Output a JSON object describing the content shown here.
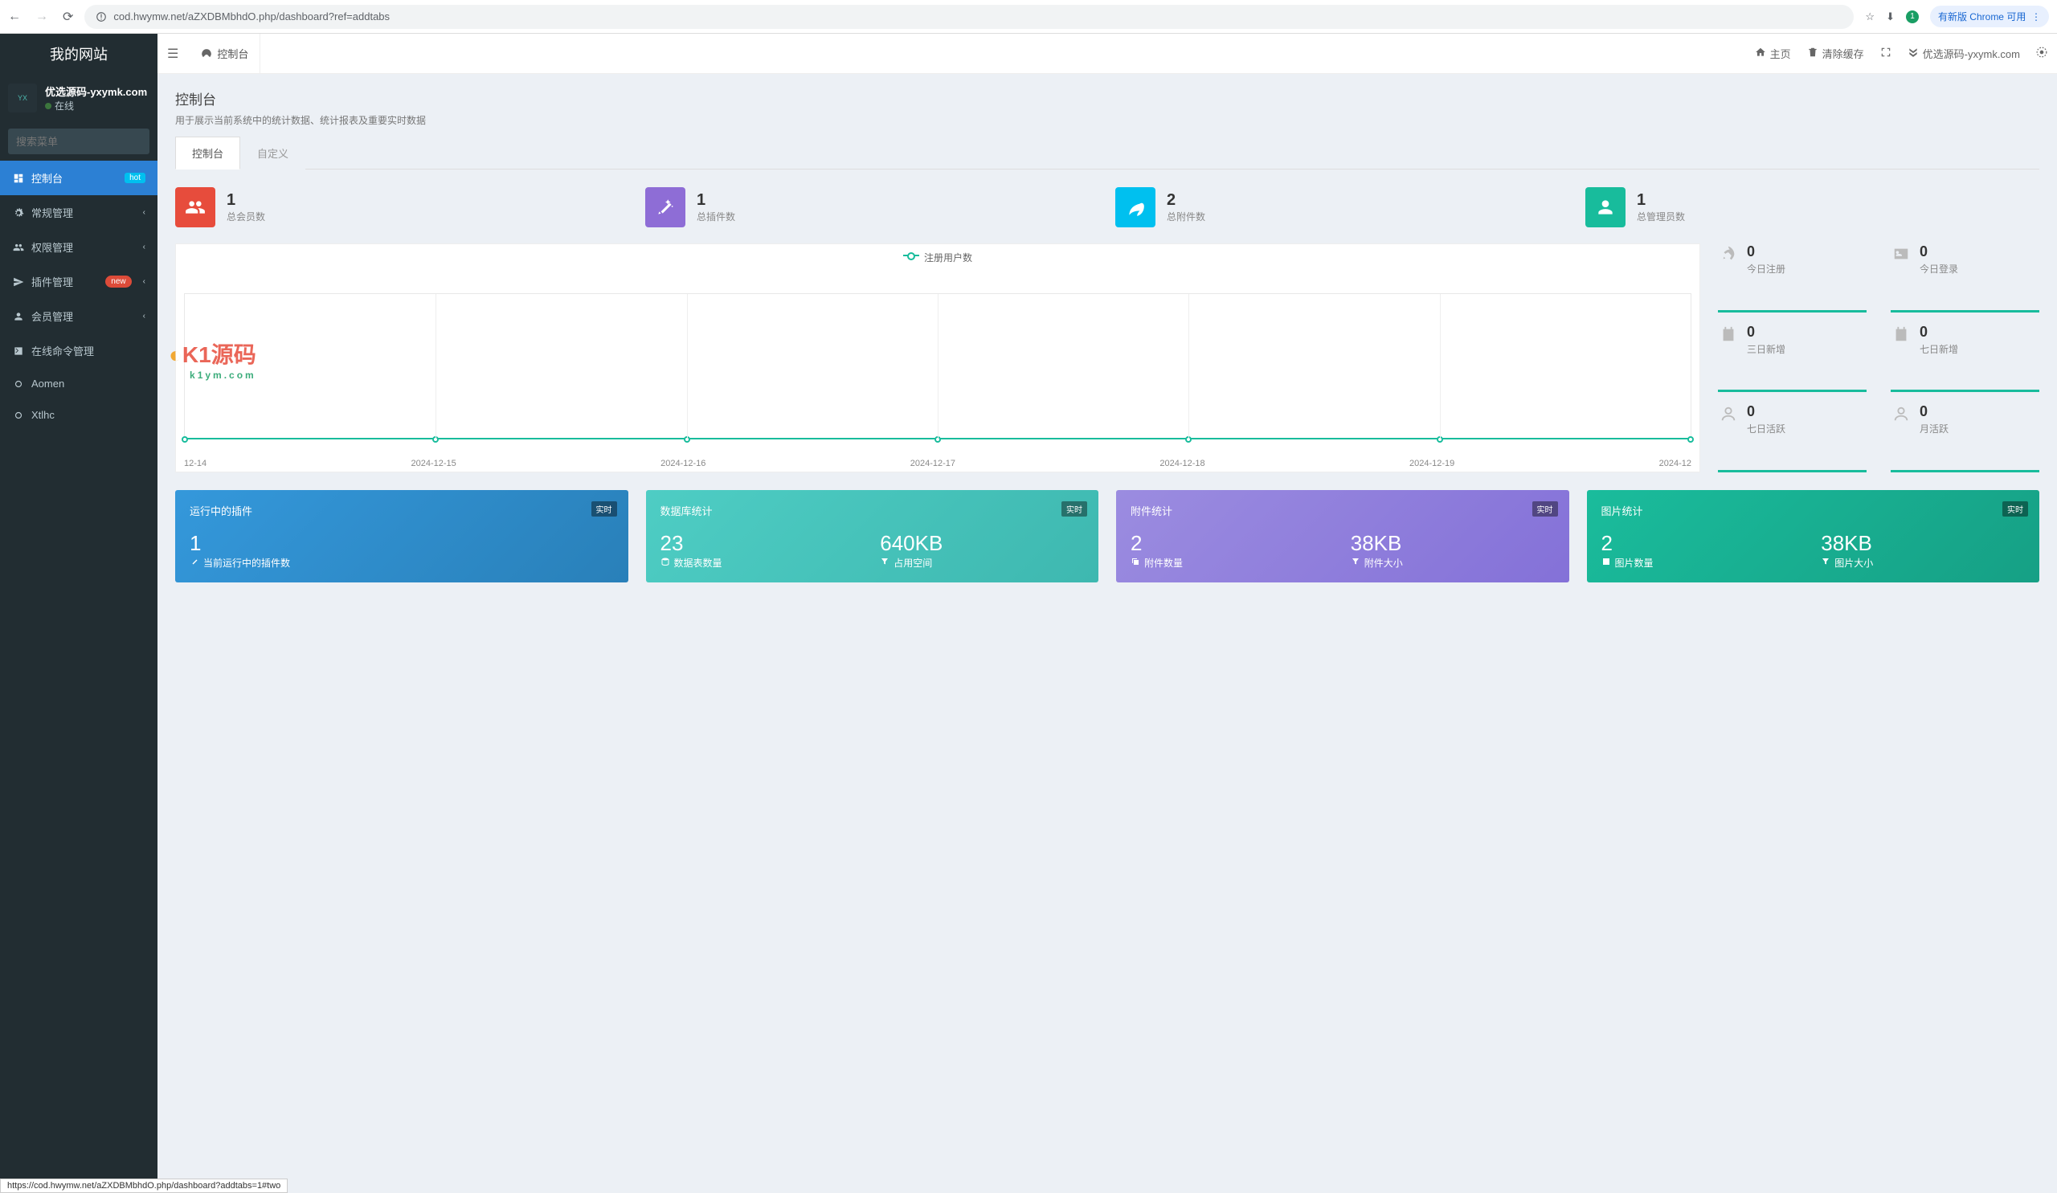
{
  "browser": {
    "url": "cod.hwymw.net/aZXDBMbhdO.php/dashboard?ref=addtabs",
    "chrome_update": "有新版 Chrome 可用",
    "avatar_badge": "1"
  },
  "sidebar": {
    "brand": "我的网站",
    "user_name": "优选源码-yxymk.com",
    "user_status": "在线",
    "search_placeholder": "搜索菜单",
    "items": [
      {
        "icon": "dashboard",
        "label": "控制台",
        "badge": "hot",
        "badge_class": "hot",
        "active": true
      },
      {
        "icon": "cogs",
        "label": "常规管理",
        "caret": true
      },
      {
        "icon": "users",
        "label": "权限管理",
        "caret": true
      },
      {
        "icon": "plane",
        "label": "插件管理",
        "badge": "new",
        "badge_class": "new",
        "caret": true
      },
      {
        "icon": "user",
        "label": "会员管理",
        "caret": true
      },
      {
        "icon": "terminal",
        "label": "在线命令管理"
      },
      {
        "icon": "circle",
        "label": "Aomen"
      },
      {
        "icon": "circle",
        "label": "Xtlhc"
      }
    ]
  },
  "topbar": {
    "tab_label": "控制台",
    "right": [
      {
        "icon": "home",
        "label": "主页"
      },
      {
        "icon": "trash",
        "label": "清除缓存"
      },
      {
        "icon": "expand",
        "label": ""
      },
      {
        "icon": "logo",
        "label": "优选源码-yxymk.com"
      },
      {
        "icon": "gears",
        "label": ""
      }
    ]
  },
  "page": {
    "title": "控制台",
    "subtitle": "用于展示当前系统中的统计数据、统计报表及重要实时数据",
    "subtabs": [
      "控制台",
      "自定义"
    ]
  },
  "stat_cards": [
    {
      "color": "c-red",
      "icon": "users",
      "num": "1",
      "label": "总会员数"
    },
    {
      "color": "c-purple",
      "icon": "wand",
      "num": "1",
      "label": "总插件数"
    },
    {
      "color": "c-blue",
      "icon": "leaf",
      "num": "2",
      "label": "总附件数"
    },
    {
      "color": "c-green",
      "icon": "user",
      "num": "1",
      "label": "总管理员数"
    }
  ],
  "chart_data": {
    "type": "line",
    "title": "",
    "legend": "注册用户数",
    "categories": [
      "12-14",
      "2024-12-15",
      "2024-12-16",
      "2024-12-17",
      "2024-12-18",
      "2024-12-19",
      "2024-12"
    ],
    "series": [
      {
        "name": "注册用户数",
        "values": [
          0,
          0,
          0,
          0,
          0,
          0,
          0
        ]
      }
    ],
    "ylim": [
      0,
      1
    ]
  },
  "side_stats": [
    {
      "icon": "rocket",
      "num": "0",
      "label": "今日注册"
    },
    {
      "icon": "idcard",
      "num": "0",
      "label": "今日登录"
    },
    {
      "icon": "calendar",
      "num": "0",
      "label": "三日新增"
    },
    {
      "icon": "calendar-plus",
      "num": "0",
      "label": "七日新增"
    },
    {
      "icon": "user-o",
      "num": "0",
      "label": "七日活跃"
    },
    {
      "icon": "user-o",
      "num": "0",
      "label": "月活跃"
    }
  ],
  "panels": [
    {
      "color": "g-blue",
      "title": "运行中的插件",
      "badge": "实时",
      "cols": [
        {
          "big": "1",
          "sub_icon": "magic",
          "sub": "当前运行中的插件数"
        }
      ]
    },
    {
      "color": "g-teal",
      "title": "数据库统计",
      "badge": "实时",
      "cols": [
        {
          "big": "23",
          "sub_icon": "database",
          "sub": "数据表数量"
        },
        {
          "big": "640KB",
          "sub_icon": "filter",
          "sub": "占用空间"
        }
      ]
    },
    {
      "color": "g-purple",
      "title": "附件统计",
      "badge": "实时",
      "cols": [
        {
          "big": "2",
          "sub_icon": "copy",
          "sub": "附件数量"
        },
        {
          "big": "38KB",
          "sub_icon": "filter",
          "sub": "附件大小"
        }
      ]
    },
    {
      "color": "g-green",
      "title": "图片统计",
      "badge": "实时",
      "cols": [
        {
          "big": "2",
          "sub_icon": "image",
          "sub": "图片数量"
        },
        {
          "big": "38KB",
          "sub_icon": "filter",
          "sub": "图片大小"
        }
      ]
    }
  ],
  "watermark": {
    "main": "K1源码",
    "sub": "k1ym.com"
  },
  "status_bar": "https://cod.hwymw.net/aZXDBMbhdO.php/dashboard?addtabs=1#two"
}
